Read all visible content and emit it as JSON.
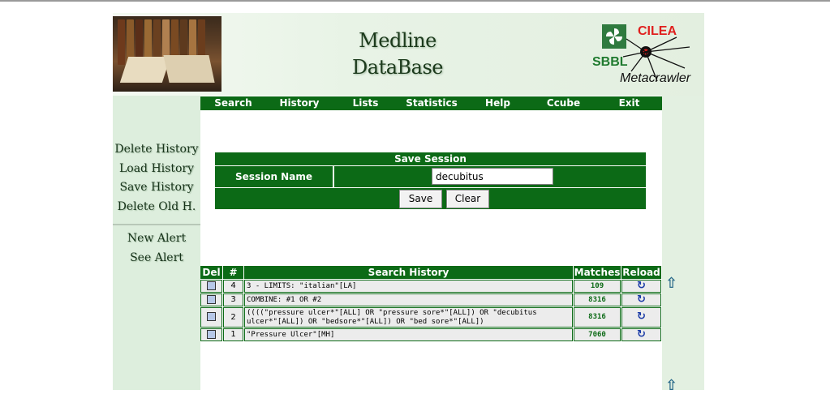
{
  "header": {
    "title_line1": "Medline",
    "title_line2": "DataBase",
    "logo_cilea": "CILEA",
    "logo_sbbl": "SBBL",
    "logo_meta": "Metacrawler"
  },
  "nav": [
    "Search",
    "History",
    "Lists",
    "Statistics",
    "Help",
    "Ccube",
    "Exit"
  ],
  "sidebar": {
    "group1": [
      "Delete History",
      "Load History",
      "Save History",
      "Delete Old H."
    ],
    "group2": [
      "New Alert",
      "See Alert"
    ]
  },
  "save_session": {
    "heading": "Save Session",
    "label": "Session Name",
    "value": "decubitus",
    "save_label": "Save",
    "clear_label": "Clear"
  },
  "history": {
    "columns": [
      "Del",
      "#",
      "Search History",
      "Matches",
      "Reload"
    ],
    "rows": [
      {
        "num": "4",
        "query": "3 - LIMITS: \"italian\"[LA]",
        "matches": "109"
      },
      {
        "num": "3",
        "query": "COMBINE: #1 OR #2",
        "matches": "8316"
      },
      {
        "num": "2",
        "query": "((((\"pressure ulcer*\"[ALL] OR \"pressure sore*\"[ALL]) OR \"decubitus ulcer*\"[ALL]) OR \"bedsore*\"[ALL]) OR \"bed sore*\"[ALL])",
        "matches": "8316"
      },
      {
        "num": "1",
        "query": "\"Pressure Ulcer\"[MH]",
        "matches": "7060"
      }
    ]
  },
  "colors": {
    "primary_green": "#0c6a16",
    "sidebar_bg": "#ddeedd",
    "logo_red": "#e0201e"
  },
  "icons": {
    "del": "trash-icon",
    "reload": "reload-icon",
    "scroll": "up-arrow-icon"
  }
}
